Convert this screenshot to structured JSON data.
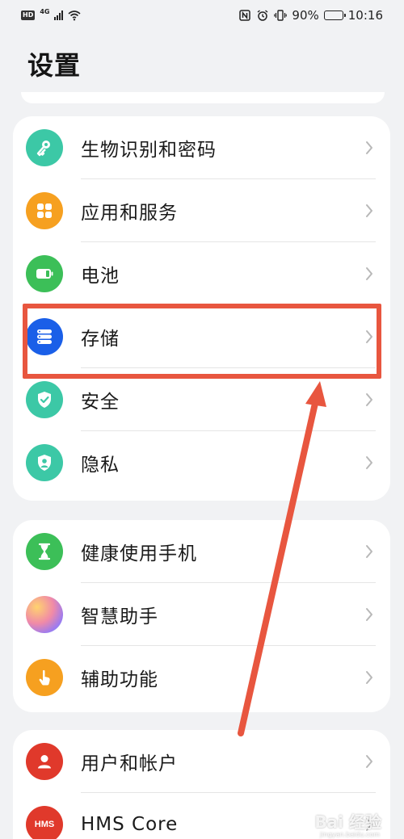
{
  "status_bar": {
    "badge": "HD",
    "network": "4G",
    "battery_text": "90%",
    "battery_level": 0.9,
    "time": "10:16"
  },
  "page": {
    "title": "设置"
  },
  "groups": [
    {
      "items": [
        {
          "label": "生物识别和密码",
          "icon": "key-icon",
          "color": "#3cc8a6"
        },
        {
          "label": "应用和服务",
          "icon": "apps-icon",
          "color": "#f6a020"
        },
        {
          "label": "电池",
          "icon": "battery-icon",
          "color": "#3cbf58"
        },
        {
          "label": "存储",
          "icon": "storage-icon",
          "color": "#1a5fe8"
        },
        {
          "label": "安全",
          "icon": "shield-check-icon",
          "color": "#3cc8a6"
        },
        {
          "label": "隐私",
          "icon": "privacy-icon",
          "color": "#3cc8a6"
        }
      ]
    },
    {
      "items": [
        {
          "label": "健康使用手机",
          "icon": "hourglass-icon",
          "color": "#3cbf58"
        },
        {
          "label": "智慧助手",
          "icon": "assistant-icon",
          "color": "#c77be8"
        },
        {
          "label": "辅助功能",
          "icon": "hand-icon",
          "color": "#f6a020"
        }
      ]
    },
    {
      "items": [
        {
          "label": "用户和帐户",
          "icon": "user-icon",
          "color": "#e0392b"
        },
        {
          "label": "HMS Core",
          "icon": "hms-icon",
          "color": "#e0392b",
          "icon_text": "HMS"
        }
      ]
    }
  ],
  "annotation": {
    "highlight_color": "#e8563f",
    "highlighted_item": "存储"
  },
  "watermark": {
    "text": "Bai 经验",
    "sub": "jingyan.baidu.com"
  }
}
